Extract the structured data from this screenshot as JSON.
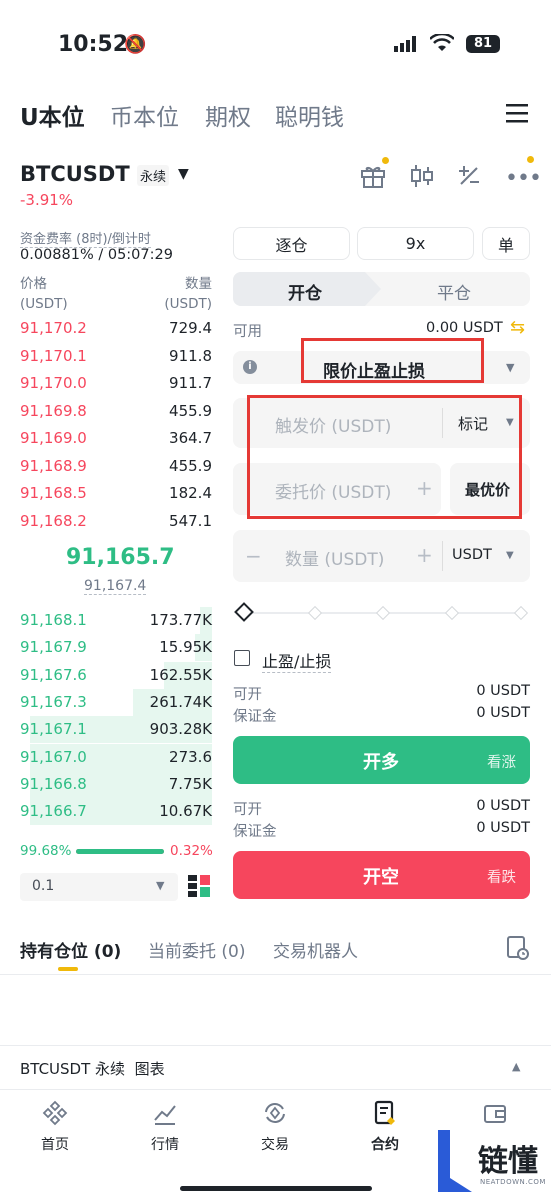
{
  "status_bar": {
    "time": "10:52",
    "battery": "81"
  },
  "top_tabs": [
    "U本位",
    "币本位",
    "期权",
    "聪明钱"
  ],
  "symbol": {
    "name": "BTCUSDT",
    "type": "永续",
    "change": "-3.91%"
  },
  "funding": {
    "label": "资金费率 (8时)/倒计时",
    "value": "0.00881% / 05:07:29"
  },
  "orderbook": {
    "price_header": "价格\n(USDT)",
    "qty_header": "数量\n(USDT)",
    "price_header_l1": "价格",
    "price_header_l2": "(USDT)",
    "qty_header_l1": "数量",
    "qty_header_l2": "(USDT)",
    "asks": [
      {
        "price": "91,170.2",
        "qty": "729.4"
      },
      {
        "price": "91,170.1",
        "qty": "911.8"
      },
      {
        "price": "91,170.0",
        "qty": "911.7"
      },
      {
        "price": "91,169.8",
        "qty": "455.9"
      },
      {
        "price": "91,169.0",
        "qty": "364.7"
      },
      {
        "price": "91,168.9",
        "qty": "455.9"
      },
      {
        "price": "91,168.5",
        "qty": "182.4"
      },
      {
        "price": "91,168.2",
        "qty": "547.1"
      }
    ],
    "last_price": "91,165.7",
    "mark_price": "91,167.4",
    "bids": [
      {
        "price": "91,168.1",
        "qty": "173.77K",
        "depth": 0.06
      },
      {
        "price": "91,167.9",
        "qty": "15.95K",
        "depth": 0.09
      },
      {
        "price": "91,167.6",
        "qty": "162.55K",
        "depth": 0.25
      },
      {
        "price": "91,167.3",
        "qty": "261.74K",
        "depth": 0.41
      },
      {
        "price": "91,167.1",
        "qty": "903.28K",
        "depth": 0.95
      },
      {
        "price": "91,167.0",
        "qty": "273.6",
        "depth": 0.95
      },
      {
        "price": "91,166.8",
        "qty": "7.75K",
        "depth": 0.95
      },
      {
        "price": "91,166.7",
        "qty": "10.67K",
        "depth": 0.95
      }
    ],
    "buy_ratio": "99.68%",
    "sell_ratio": "0.32%",
    "buy_ratio_value": 0.9968,
    "precision": "0.1"
  },
  "order_form": {
    "margin_mode": "逐仓",
    "leverage": "9x",
    "position_mode": "单",
    "open_tab": "开仓",
    "close_tab": "平仓",
    "available_label": "可用",
    "available_value": "0.00 USDT",
    "order_type": "限价止盈止损",
    "trigger_placeholder": "触发价 (USDT)",
    "trigger_type": "标记",
    "limit_placeholder": "委托价 (USDT)",
    "best_price": "最优价",
    "qty_placeholder": "数量 (USDT)",
    "qty_unit": "USDT",
    "tpsl_label": "止盈/止损",
    "long_can_open_label": "可开",
    "long_can_open_value": "0 USDT",
    "long_margin_label": "保证金",
    "long_margin_value": "0 USDT",
    "long_button": "开多",
    "long_hint": "看涨",
    "short_can_open_label": "可开",
    "short_can_open_value": "0 USDT",
    "short_margin_label": "保证金",
    "short_margin_value": "0 USDT",
    "short_button": "开空",
    "short_hint": "看跌",
    "minus": "−",
    "plus": "+"
  },
  "bottom_tabs": [
    "持有仓位 (0)",
    "当前委托 (0)",
    "交易机器人"
  ],
  "chart_bar": {
    "label": "BTCUSDT 永续  图表"
  },
  "nav": [
    "首页",
    "行情",
    "交易",
    "合约",
    "资产"
  ],
  "watermark": {
    "brand": "链懂",
    "sub": "NEATDOWN.COM"
  },
  "colors": {
    "green": "#2ebd85",
    "red": "#f6465d",
    "accent": "#f0b90b",
    "highlight": "#e53935"
  }
}
